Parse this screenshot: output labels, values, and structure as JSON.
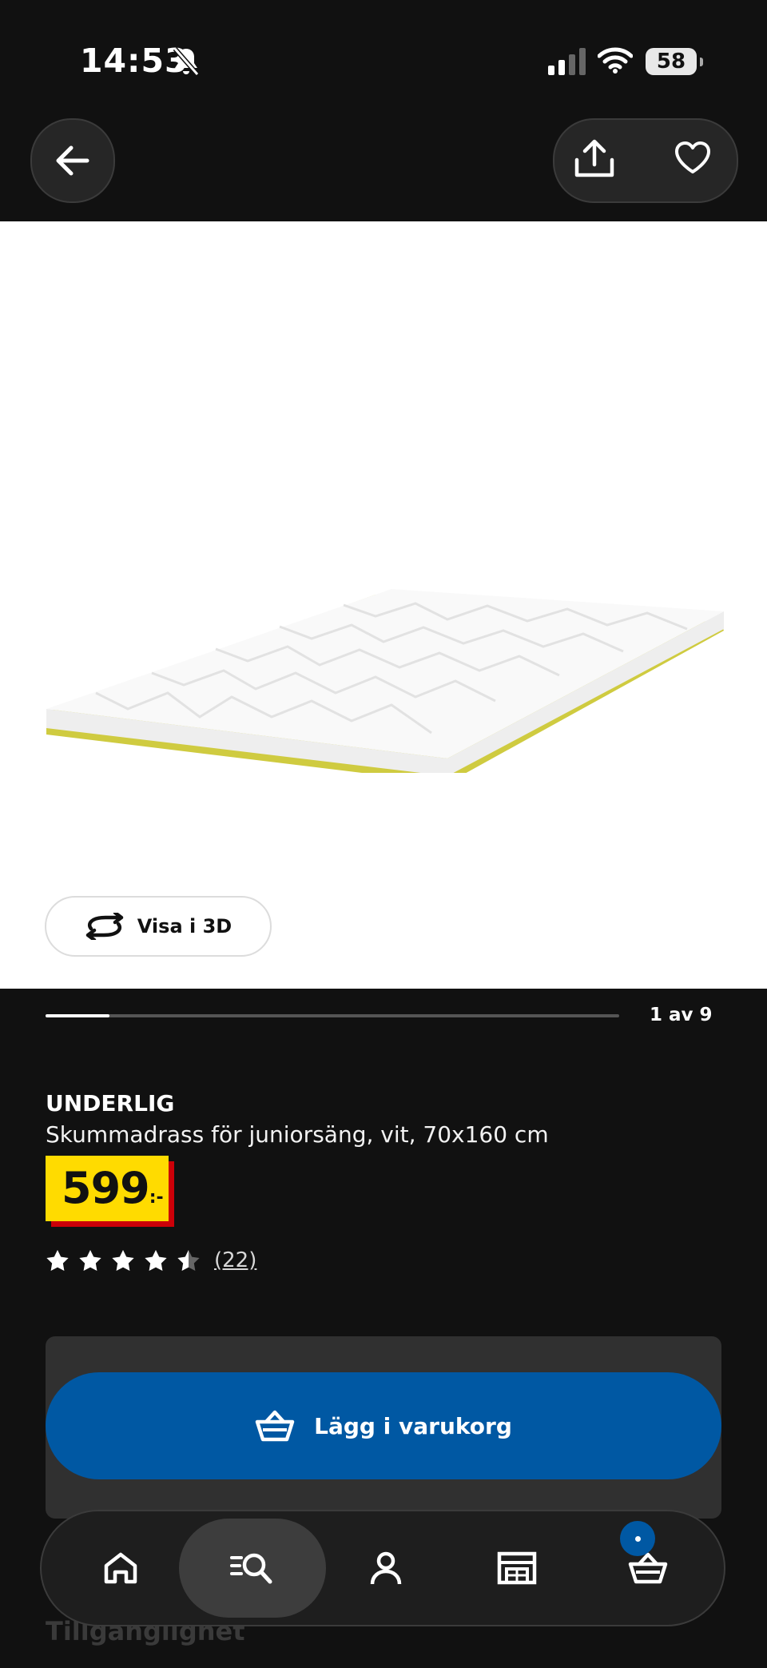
{
  "status_bar": {
    "time": "14:53",
    "battery": "58"
  },
  "gallery": {
    "view_3d_label": "Visa i 3D",
    "pager_text": "1 av 9",
    "progress": 0.111
  },
  "product": {
    "name": "UNDERLIG",
    "description": "Skummadrass för juniorsäng, vit, 70x160 cm",
    "price": "599",
    "price_suffix": ":-",
    "rating": 4.5,
    "rating_count": "(22)"
  },
  "cart": {
    "add_label": "Lägg i varukorg"
  },
  "below_fold": {
    "partial_heading": "Tillgänglighet"
  },
  "colors": {
    "accent_blue": "#0058a3",
    "price_yellow": "#ffdb00",
    "price_red": "#cc0008",
    "background": "#111111"
  },
  "icons": {
    "top": [
      "back-arrow-icon",
      "share-icon",
      "heart-icon"
    ],
    "nav": [
      "home-icon",
      "search-icon",
      "profile-icon",
      "store-icon",
      "cart-icon"
    ]
  }
}
